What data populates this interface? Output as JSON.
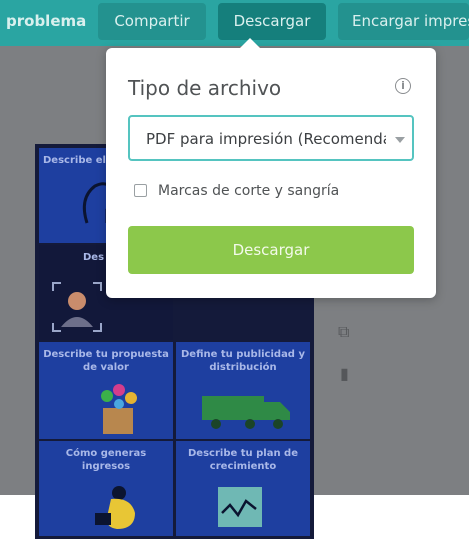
{
  "toolbar": {
    "problema_label": "problema",
    "compartir_label": "Compartir",
    "descargar_label": "Descargar",
    "encargar_label": "Encargar impresión"
  },
  "canvas": {
    "cells": [
      {
        "title": "Describe el"
      },
      {
        "title": "Des"
      },
      {
        "title": "Describe tu propuesta de valor"
      },
      {
        "title": "Define tu publicidad y distribución"
      },
      {
        "title": "Cómo generas ingresos"
      },
      {
        "title": "Describe tu plan de crecimiento"
      }
    ]
  },
  "popup": {
    "title": "Tipo de archivo",
    "file_type_value": "PDF para impresión (Recomendado)",
    "crop_marks_label": "Marcas de corte y sangría",
    "crop_marks_checked": false,
    "download_label": "Descargar"
  },
  "colors": {
    "toolbar": "#2aa5a2",
    "accent_border": "#55c4c0",
    "download_button": "#8cc84b"
  }
}
